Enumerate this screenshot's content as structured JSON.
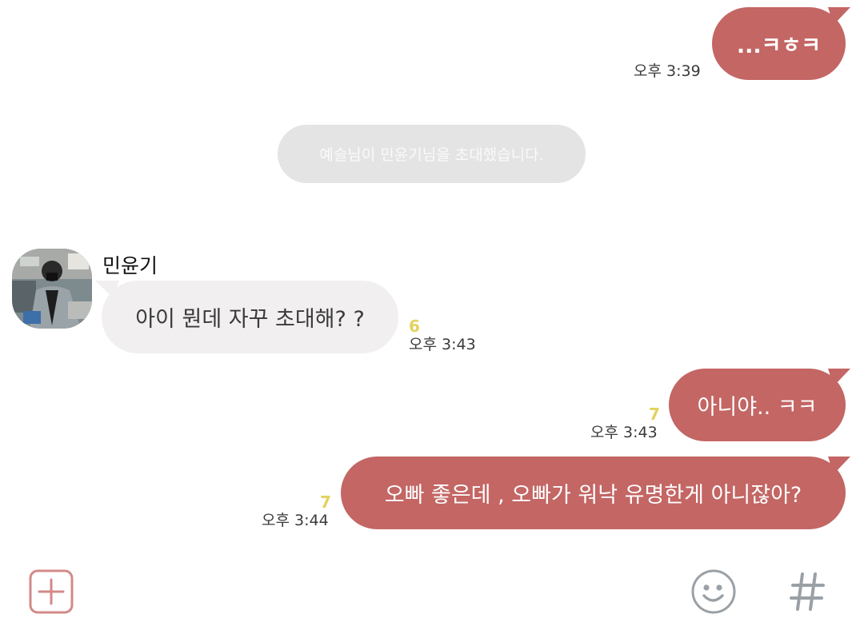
{
  "messages": [
    {
      "id": "m1",
      "side": "out",
      "text": "...ㅋㅎㅋ",
      "time": "오후 3:39",
      "unread": ""
    },
    {
      "id": "m2",
      "side": "in",
      "sender": "민윤기",
      "text": "아이 뭔데 자꾸 초대해? ?",
      "time": "오후 3:43",
      "unread": "6"
    },
    {
      "id": "m3",
      "side": "out",
      "text": "아니야.. ㅋㅋ",
      "time": "오후 3:43",
      "unread": "7"
    },
    {
      "id": "m4",
      "side": "out",
      "text": "오빠 좋은데 , 오빠가 워낙 유명한게 아니잖아?",
      "time": "오후 3:44",
      "unread": "7"
    }
  ],
  "system_notice": "예슬님이 민윤기님을 초대했습니다.",
  "input_bar": {
    "add_icon": "plus-square-icon",
    "emoji_icon": "smiley-icon",
    "hashtag_icon": "hashtag-icon"
  },
  "colors": {
    "out_bubble": "#c36664",
    "in_bubble": "#f1efef",
    "system_pill": "#e4e4e4",
    "unread": "#e3d25c",
    "add_icon": "#d38a88",
    "toolbar_icon": "#9aa0a6"
  }
}
